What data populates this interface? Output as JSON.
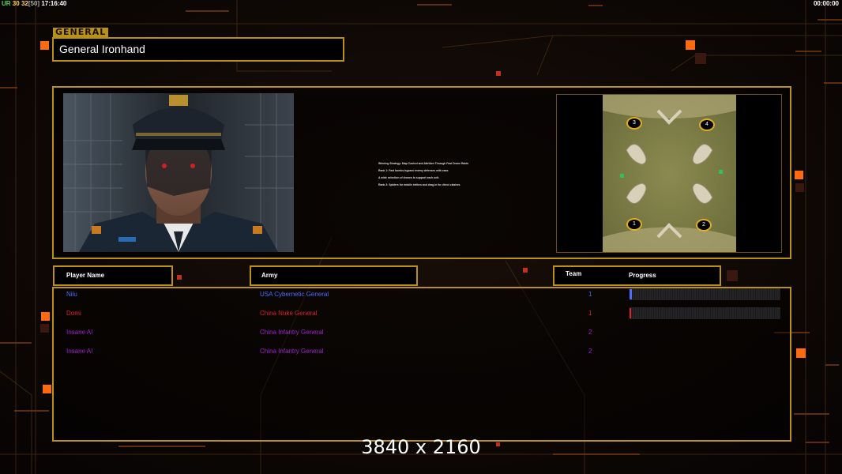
{
  "hud": {
    "left_label": "UR",
    "left_value_a": "30",
    "left_value_b": "32",
    "left_bracket": "[50]",
    "clock": "17:16:40",
    "timer": "00:00:00"
  },
  "colors": {
    "accent": "#b8901a",
    "orange_light": "#ff7a1a",
    "blue_player": "#4a6cff",
    "red_player": "#e0202a",
    "purple_player": "#a020d0"
  },
  "general": {
    "tag": "GENERAL",
    "name": "General Ironhand"
  },
  "strategy": {
    "title": "Winning Strategy: Map Control and Attrition Through Fast Drone Raids",
    "lines": [
      "Rank 1: Fast bombs bypass enemy defenses with ease.",
      "A wide selection of drones to support each unit.",
      "Rank 3: Spiders for mobile strikes and drag-in for direct clashes."
    ]
  },
  "map": {
    "start_positions": [
      "3",
      "4",
      "1",
      "2"
    ]
  },
  "table": {
    "headers": {
      "player": "Player Name",
      "army": "Army",
      "team": "Team",
      "progress": "Progress"
    },
    "rows": [
      {
        "player": "Nilu",
        "army": "USA Cybernetic General",
        "team": "1",
        "color": "#4a6cff",
        "progress": 0.015
      },
      {
        "player": "Domi",
        "army": "China Nuke General",
        "team": "1",
        "color": "#e0202a",
        "progress": 0.01
      },
      {
        "player": "Insane AI",
        "army": "China Infantry General",
        "team": "2",
        "color": "#a020d0"
      },
      {
        "player": "Insane AI",
        "army": "China Infantry General",
        "team": "2",
        "color": "#a020d0"
      }
    ]
  },
  "resolution_label": "3840 x 2160"
}
